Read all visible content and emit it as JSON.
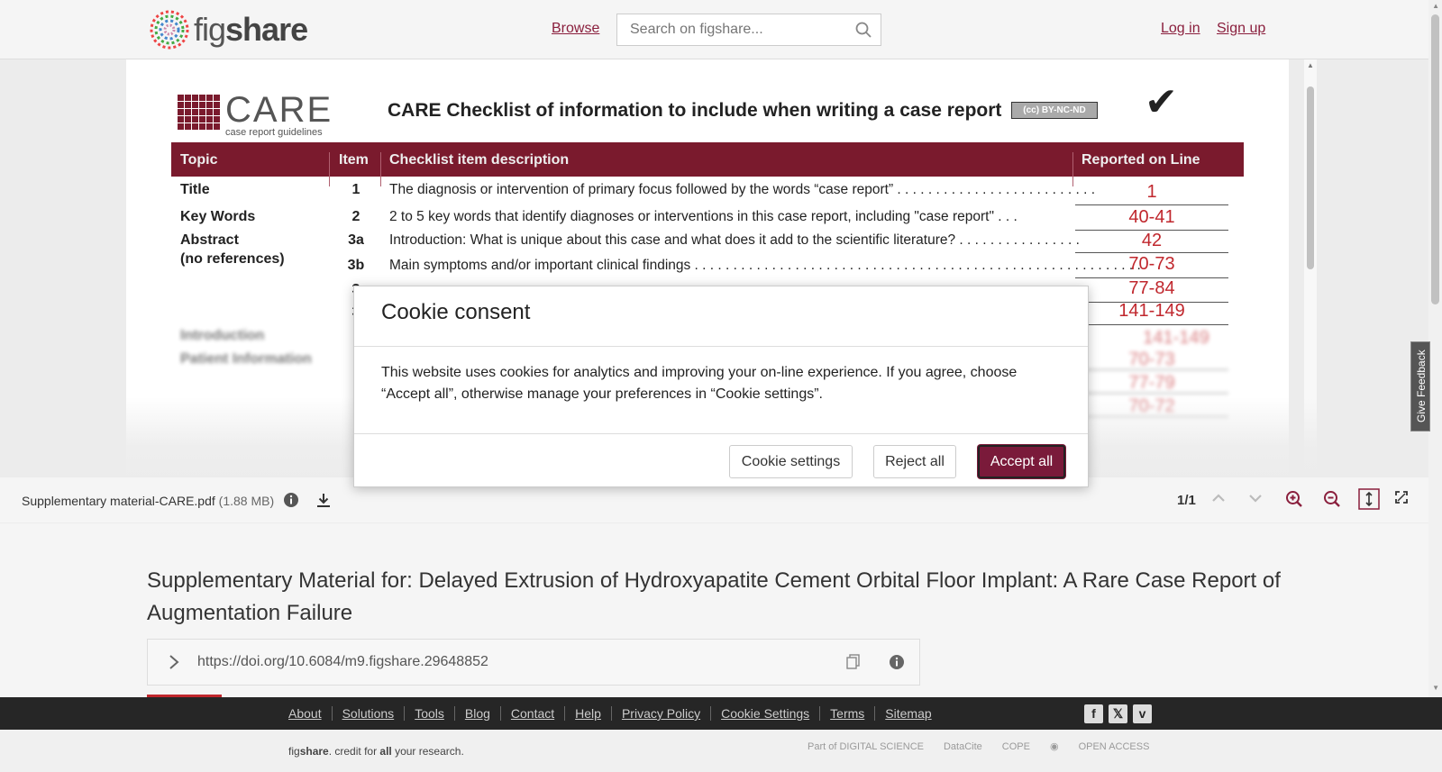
{
  "header": {
    "logo_prefix": "fig",
    "logo_suffix": "share",
    "browse": "Browse",
    "search_placeholder": "Search on figshare...",
    "login": "Log in",
    "signup": "Sign up"
  },
  "pdf": {
    "care_brand": "CARE",
    "care_tagline": "case report guidelines",
    "doc_title": "CARE Checklist of information to include when writing a case report",
    "license": "BY-NC-ND",
    "columns": [
      "Topic",
      "Item",
      "Checklist item description",
      "Reported on Line"
    ],
    "rows": [
      {
        "topic": "Title",
        "topic2": "",
        "item": "1",
        "desc": "The diagnosis or intervention of primary focus followed by the words “case report” . . . . . . . . . . . . . . . . . .  . . . . . . . .",
        "line": "1"
      },
      {
        "topic": "Key Words",
        "topic2": "",
        "item": "2",
        "desc": "2 to 5 key words that identify diagnoses or interventions in this case report, including \"case report\"  . . .",
        "line": "40-41"
      },
      {
        "topic": "Abstract",
        "topic2": "(no references)",
        "item": "3a",
        "desc": "Introduction: What is unique about this case and what does it add to the scientific literature? . . . . . . . . . . . . . . . .",
        "line": "42"
      },
      {
        "topic": "",
        "topic2": "",
        "item": "3b",
        "desc": "Main symptoms and/or important clinical findings . . . . . . . . . . . . . . . . . . . . . . . . . . . . . . . . . . . . . . . . . . . . . . . . . . . . . .  . . . .",
        "line": "70-73"
      },
      {
        "topic": "",
        "topic2": "",
        "item": "3",
        "desc": "",
        "line": "77-84"
      },
      {
        "topic": "",
        "topic2": "",
        "item": "3",
        "desc": "",
        "line": "141-149"
      },
      {
        "topic": "Introduction",
        "topic2": "",
        "item": "",
        "desc": "",
        "line": "141-149"
      },
      {
        "topic": "Patient Information",
        "topic2": "",
        "item": "",
        "desc": "",
        "line": "70-73"
      },
      {
        "topic": "",
        "topic2": "",
        "item": "",
        "desc": "",
        "line": "77-79"
      },
      {
        "topic": "",
        "topic2": "",
        "item": "",
        "desc": "",
        "line": "70-72"
      }
    ]
  },
  "file_bar": {
    "file_name": "Supplementary material-CARE.pdf",
    "file_size": "(1.88 MB)",
    "page": "1/1"
  },
  "article": {
    "title": "Supplementary Material for: Delayed Extrusion of Hydroxyapatite Cement Orbital Floor Implant: A Rare Case Report of Augmentation Failure",
    "doi": "https://doi.org/10.6084/m9.figshare.29648852"
  },
  "footer": {
    "links": [
      "About",
      "Solutions",
      "Tools",
      "Blog",
      "Contact",
      "Help",
      "Privacy Policy",
      "Cookie Settings",
      "Terms",
      "Sitemap"
    ],
    "tagline_fig": "fig",
    "tagline_share": "share",
    "tagline_mid": ". credit for ",
    "tagline_all": "all",
    "tagline_end": " your research.",
    "partners": [
      "Part of DIGITAL SCIENCE",
      "DataCite",
      "COPE",
      "",
      "OPEN ACCESS"
    ]
  },
  "feedback": "Give Feedback",
  "cookie": {
    "title": "Cookie consent",
    "body": "This website uses cookies for analytics and improving your on-line experience. If you agree, choose “Accept all”, otherwise manage your preferences in “Cookie settings”.",
    "settings": "Cookie settings",
    "reject": "Reject all",
    "accept": "Accept all"
  },
  "colors": {
    "brand": "#8a1f3d",
    "care_red": "#7a1a2d",
    "accept_bg": "#7a1a3a"
  }
}
